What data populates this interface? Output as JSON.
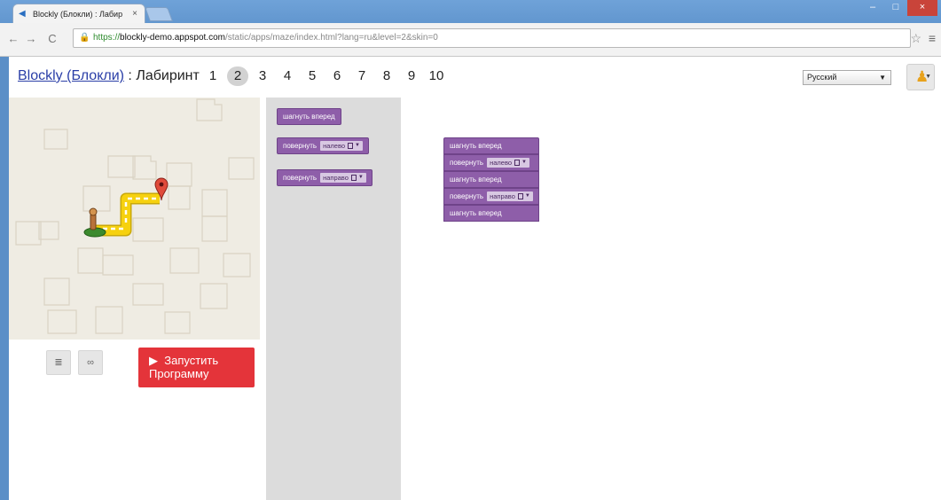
{
  "browser": {
    "tab_title": "Blockly (Блокли) : Лабир",
    "tab_close": "×",
    "url_scheme": "https://",
    "url_host": "blockly-demo.appspot.com",
    "url_path": "/static/apps/maze/index.html?lang=ru&level=2&skin=0",
    "window_buttons": [
      "–",
      "□",
      "×"
    ],
    "nav_icons": [
      "back-icon",
      "forward-icon",
      "reload-icon",
      "lock-icon",
      "star-icon",
      "menu-icon"
    ]
  },
  "header": {
    "app_link": "Blockly (Блокли)",
    "separator": " : ",
    "app_name": "Лабиринт",
    "levels": [
      "1",
      "2",
      "3",
      "4",
      "5",
      "6",
      "7",
      "8",
      "9",
      "10"
    ],
    "current_level": "2",
    "language": "Русский"
  },
  "controls": {
    "code_icon": "code-icon",
    "link_icon": "link-icon",
    "run_icon": "▶",
    "run_label": "Запустить Программу"
  },
  "toolbox": {
    "blocks": [
      {
        "text": "шагнуть вперед"
      },
      {
        "text": "повернуть",
        "dropdown": "налево"
      },
      {
        "text": "повернуть",
        "dropdown": "направо"
      }
    ]
  },
  "workspace": {
    "program": [
      {
        "text": "шагнуть вперед"
      },
      {
        "text": "повернуть",
        "dropdown": "налево"
      },
      {
        "text": "шагнуть вперед"
      },
      {
        "text": "повернуть",
        "dropdown": "направо"
      },
      {
        "text": "шагнуть вперед"
      }
    ]
  },
  "colors": {
    "block": "#8e5ea9",
    "run_button": "#e4343a",
    "path": "#f6d10f",
    "toolbox": "#dcdcdc",
    "maze_bg": "#efece3"
  }
}
